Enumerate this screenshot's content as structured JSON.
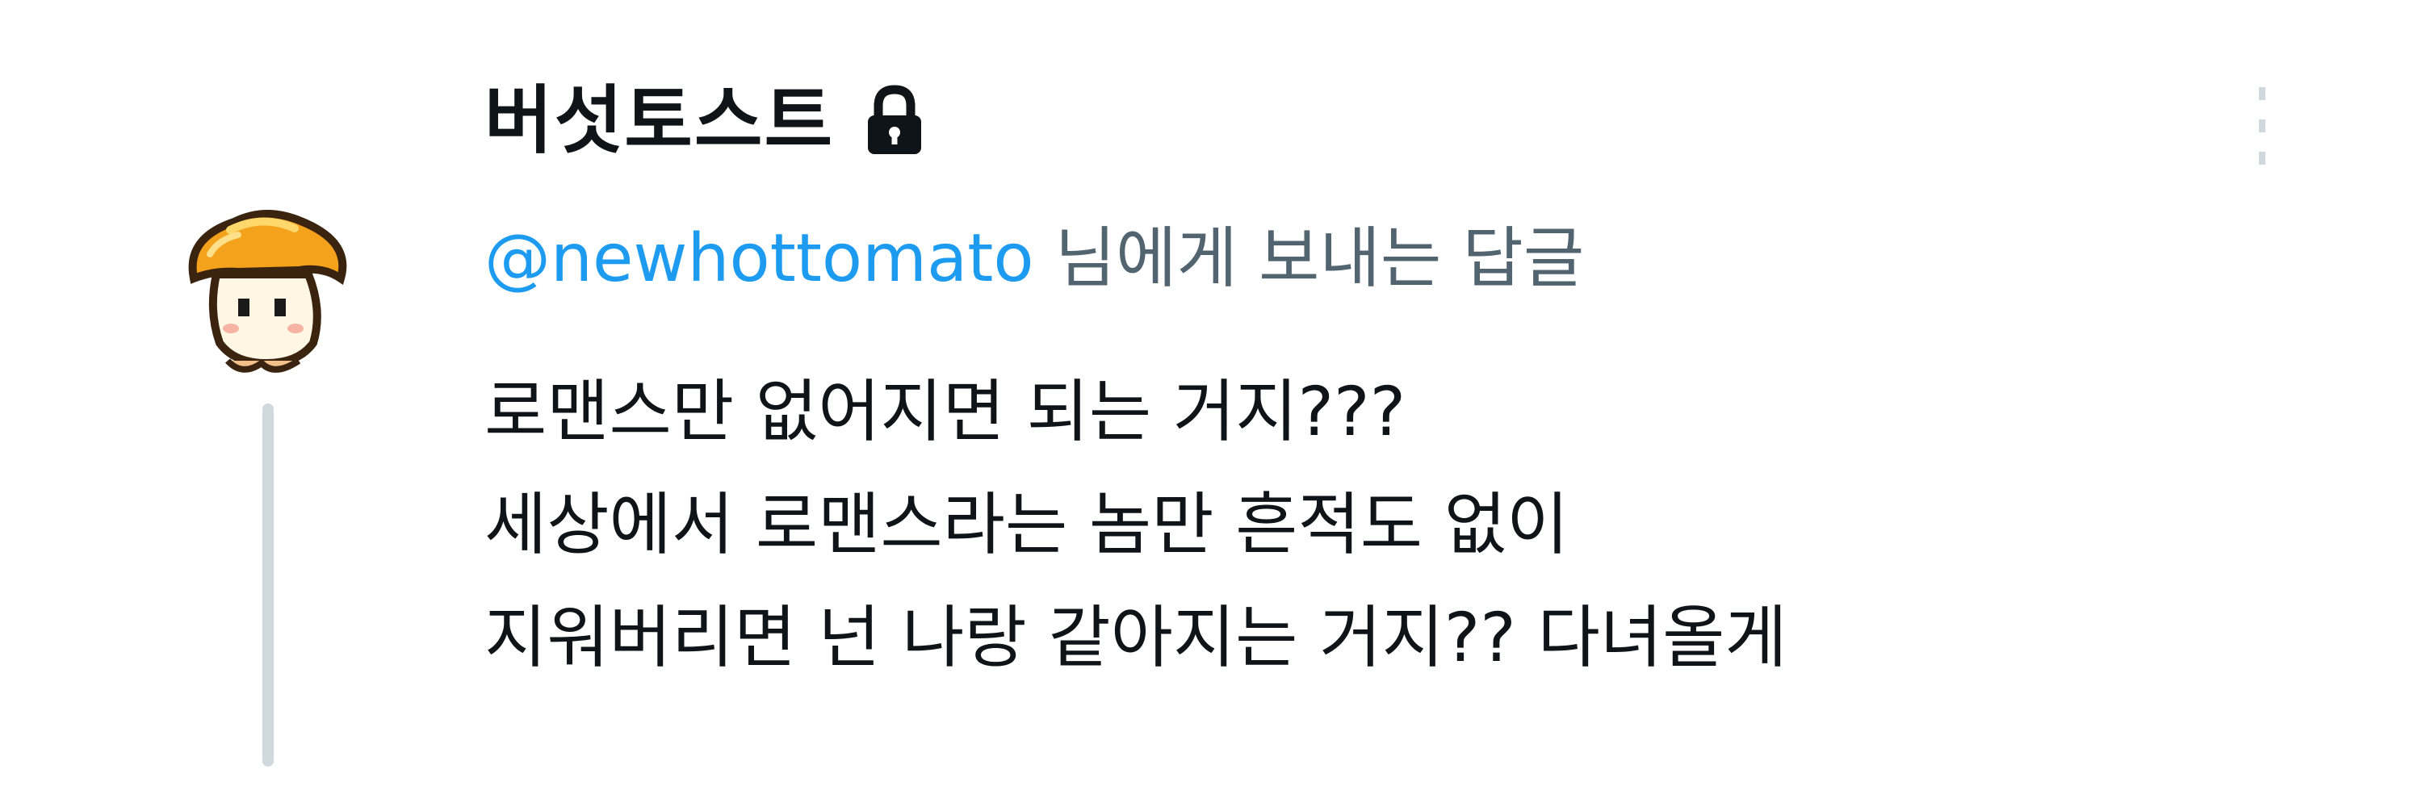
{
  "tweet": {
    "display_name": "버섯토스트",
    "protected_icon": "lock-icon",
    "more_icon": "more-vertical-icon",
    "avatar_icon": "orange-mushroom-avatar",
    "reply_to": {
      "mention": "@newhottomato",
      "suffix": " 님에게 보내는 답글"
    },
    "lines": [
      "로맨스만 없어지면 되는 거지???",
      "세상에서 로맨스라는 놈만 흔적도 없이",
      "지워버리면 넌 나랑 같아지는 거지?? 다녀올게"
    ]
  },
  "colors": {
    "text": "#0f1419",
    "secondary": "#536471",
    "link": "#1d9bf0",
    "thread_line": "#cfd9de"
  }
}
